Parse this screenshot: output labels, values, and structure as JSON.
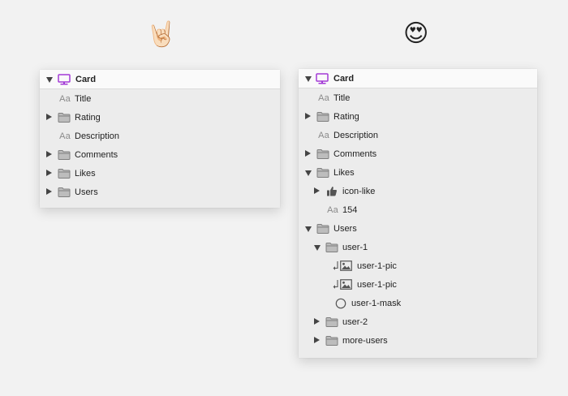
{
  "emojis": {
    "left": "🤘🏻",
    "right": "😍"
  },
  "colors": {
    "accent": "#a33ad6",
    "folder": "#9a9a9a",
    "panel": "#ececec",
    "header": "#fafafa"
  },
  "left_panel": {
    "header": {
      "label": "Card",
      "icon": "monitor-icon"
    },
    "rows": [
      {
        "label": "Title",
        "type": "text",
        "icon": "text-layer-icon"
      },
      {
        "label": "Rating",
        "type": "group",
        "icon": "folder-icon",
        "expanded": false
      },
      {
        "label": "Description",
        "type": "text",
        "icon": "text-layer-icon"
      },
      {
        "label": "Comments",
        "type": "group",
        "icon": "folder-icon",
        "expanded": false
      },
      {
        "label": "Likes",
        "type": "group",
        "icon": "folder-icon",
        "expanded": false
      },
      {
        "label": "Users",
        "type": "group",
        "icon": "folder-icon",
        "expanded": false
      }
    ]
  },
  "right_panel": {
    "header": {
      "label": "Card",
      "icon": "monitor-icon"
    },
    "rows": [
      {
        "label": "Title",
        "type": "text",
        "icon": "text-layer-icon"
      },
      {
        "label": "Rating",
        "type": "group",
        "icon": "folder-icon",
        "expanded": false
      },
      {
        "label": "Description",
        "type": "text",
        "icon": "text-layer-icon"
      },
      {
        "label": "Comments",
        "type": "group",
        "icon": "folder-icon",
        "expanded": false
      },
      {
        "label": "Likes",
        "type": "group",
        "icon": "folder-icon",
        "expanded": true
      },
      {
        "label": "icon-like",
        "type": "symbol",
        "icon": "thumbs-up-icon",
        "expanded": false
      },
      {
        "label": "154",
        "type": "text",
        "icon": "text-layer-icon"
      },
      {
        "label": "Users",
        "type": "group",
        "icon": "folder-icon",
        "expanded": true
      },
      {
        "label": "user-1",
        "type": "group",
        "icon": "folder-icon",
        "expanded": true
      },
      {
        "label": "user-1-pic",
        "type": "image",
        "icon": "image-icon",
        "masked": true
      },
      {
        "label": "user-1-pic",
        "type": "image",
        "icon": "image-icon",
        "masked": true
      },
      {
        "label": "user-1-mask",
        "type": "shape",
        "icon": "circle-mask-icon"
      },
      {
        "label": "user-2",
        "type": "group",
        "icon": "folder-icon",
        "expanded": false
      },
      {
        "label": "more-users",
        "type": "group",
        "icon": "folder-icon",
        "expanded": false
      }
    ]
  }
}
